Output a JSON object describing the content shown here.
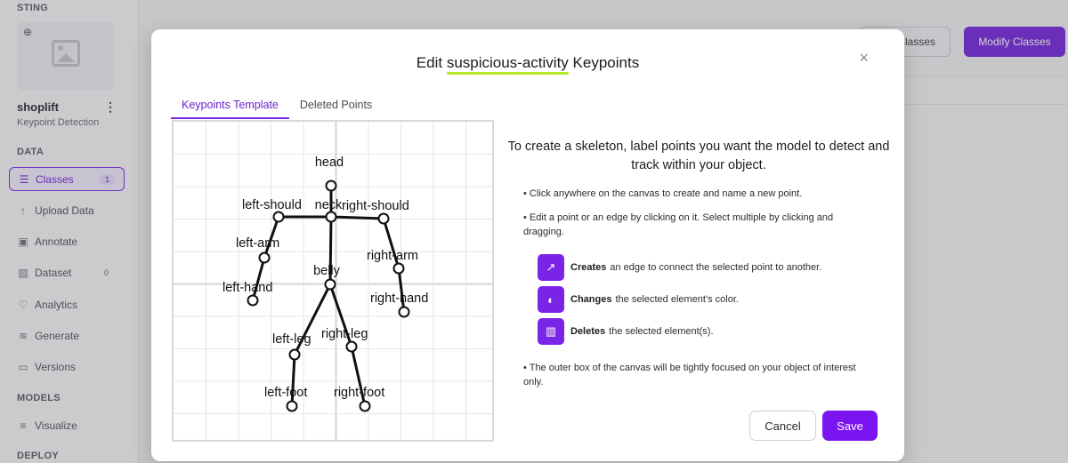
{
  "sidebar": {
    "top_label": "STING",
    "project_name": "shoplift",
    "project_type": "Keypoint Detection",
    "data_section": "DATA",
    "items": [
      {
        "label": "Classes",
        "badge": "1"
      },
      {
        "label": "Upload Data"
      },
      {
        "label": "Annotate"
      },
      {
        "label": "Dataset",
        "badge": "0"
      },
      {
        "label": "Analytics"
      },
      {
        "label": "Generate"
      },
      {
        "label": "Versions"
      }
    ],
    "models_section": "MODELS",
    "model_items": [
      {
        "label": "Visualize"
      }
    ],
    "deploy_section": "DEPLOY"
  },
  "header": {
    "classes_button": "Classes",
    "modify_button": "Modify Classes"
  },
  "modal": {
    "title_prefix": "Edit ",
    "title_object": "suspicious-activity",
    "title_suffix": " Keypoints",
    "close_icon": "×",
    "tabs": [
      {
        "label": "Keypoints Template",
        "active": true
      },
      {
        "label": "Deleted Points",
        "active": false
      }
    ],
    "instructions": {
      "heading": "To create a skeleton, label points you want the model to detect and track within your object.",
      "bullet1": "Click anywhere on the canvas to create and name a new point.",
      "bullet2": "Edit a point or an edge by clicking on it. Select multiple by clicking and dragging.",
      "tools": [
        {
          "icon": "arrow-diagonal-icon",
          "bold": "Creates",
          "text": "an edge to connect the selected point to another."
        },
        {
          "icon": "palette-icon",
          "bold": "Changes",
          "text": "the selected element's color."
        },
        {
          "icon": "trash-icon",
          "bold": "Deletes",
          "text": "the selected element(s)."
        }
      ],
      "bullet3": "The outer box of the canvas will be tightly focused on your object of interest only."
    },
    "cancel_label": "Cancel",
    "save_label": "Save"
  },
  "keypoints": [
    {
      "name": "head",
      "label": "head"
    },
    {
      "name": "neck",
      "label": "neck"
    },
    {
      "name": "left-should",
      "label": "left-should"
    },
    {
      "name": "right-should",
      "label": "right-should"
    },
    {
      "name": "left-arm",
      "label": "left-arm"
    },
    {
      "name": "right-arm",
      "label": "right-arm"
    },
    {
      "name": "left-hand",
      "label": "left-hand"
    },
    {
      "name": "right-hand",
      "label": "right-hand"
    },
    {
      "name": "belly",
      "label": "belly"
    },
    {
      "name": "left-leg",
      "label": "left-leg"
    },
    {
      "name": "right-leg",
      "label": "right-leg"
    },
    {
      "name": "left-foot",
      "label": "left-foot"
    },
    {
      "name": "right-foot",
      "label": "right-foot"
    }
  ],
  "edges": [
    [
      "head",
      "neck"
    ],
    [
      "neck",
      "left-should"
    ],
    [
      "neck",
      "right-should"
    ],
    [
      "left-should",
      "left-arm"
    ],
    [
      "left-arm",
      "left-hand"
    ],
    [
      "right-should",
      "right-arm"
    ],
    [
      "right-arm",
      "right-hand"
    ],
    [
      "neck",
      "belly"
    ],
    [
      "belly",
      "left-leg"
    ],
    [
      "belly",
      "right-leg"
    ],
    [
      "left-leg",
      "left-foot"
    ],
    [
      "right-leg",
      "right-foot"
    ]
  ],
  "colors": {
    "accent": "#7a24e8",
    "highlight": "#b6ea2a"
  }
}
